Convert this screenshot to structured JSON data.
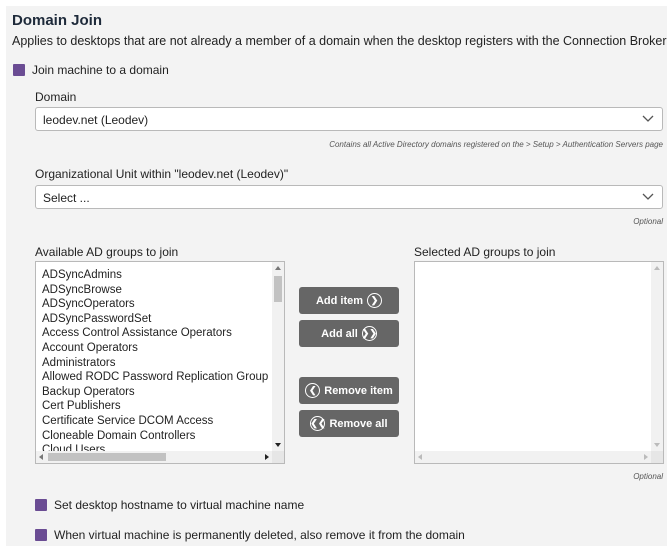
{
  "header": {
    "title": "Domain Join",
    "subtitle": "Applies to desktops that are not already a member of a domain when the desktop registers with the Connection Broker."
  },
  "join_checkbox": {
    "label": "Join machine to a domain",
    "checked": true
  },
  "domain": {
    "label": "Domain",
    "value": "leodev.net (Leodev)",
    "hint": "Contains all Active Directory domains registered on the > Setup > Authentication Servers page"
  },
  "ou": {
    "label": "Organizational Unit within \"leodev.net (Leodev)\"",
    "value": "Select ...",
    "hint": "Optional"
  },
  "available_groups": {
    "label": "Available AD groups to join",
    "items": [
      "ADSyncAdmins",
      "ADSyncBrowse",
      "ADSyncOperators",
      "ADSyncPasswordSet",
      "Access Control Assistance Operators",
      "Account Operators",
      "Administrators",
      "Allowed RODC Password Replication Group",
      "Backup Operators",
      "Cert Publishers",
      "Certificate Service DCOM Access",
      "Cloneable Domain Controllers",
      "Cloud Users"
    ]
  },
  "selected_groups": {
    "label": "Selected AD groups to join",
    "items": [],
    "hint": "Optional"
  },
  "buttons": {
    "add_item": "Add item",
    "add_all": "Add all",
    "remove_item": "Remove item",
    "remove_all": "Remove all"
  },
  "options": {
    "hostname": {
      "label": "Set desktop hostname to virtual machine name",
      "checked": true
    },
    "remove_on_delete": {
      "label": "When virtual machine is permanently deleted, also remove it from the domain",
      "checked": true
    }
  },
  "colors": {
    "checkbox": "#6a4c93",
    "button": "#666666",
    "panel": "#f3f3f3"
  }
}
